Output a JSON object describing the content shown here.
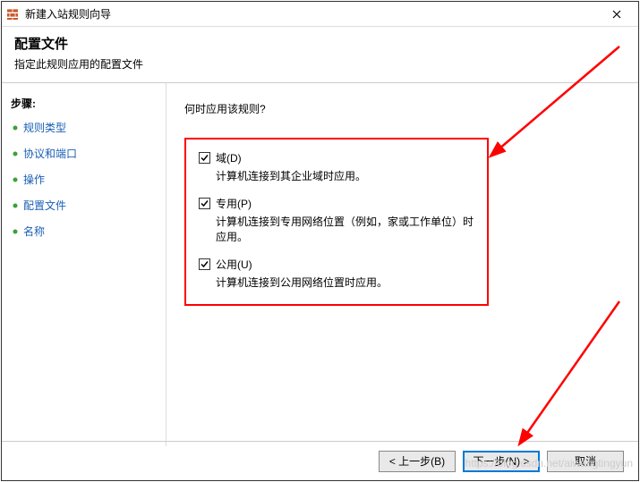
{
  "window": {
    "title": "新建入站规则向导"
  },
  "header": {
    "title": "配置文件",
    "subtitle": "指定此规则应用的配置文件"
  },
  "sidebar": {
    "heading": "步骤:",
    "steps": [
      {
        "label": "规则类型"
      },
      {
        "label": "协议和端口"
      },
      {
        "label": "操作"
      },
      {
        "label": "配置文件"
      },
      {
        "label": "名称"
      }
    ]
  },
  "main": {
    "prompt": "何时应用该规则?",
    "options": [
      {
        "label": "域(D)",
        "desc": "计算机连接到其企业域时应用。",
        "checked": true
      },
      {
        "label": "专用(P)",
        "desc": "计算机连接到专用网络位置（例如，家或工作单位）时应用。",
        "checked": true
      },
      {
        "label": "公用(U)",
        "desc": "计算机连接到公用网络位置时应用。",
        "checked": true
      }
    ]
  },
  "footer": {
    "back": "< 上一步(B)",
    "next": "下一步(N) >",
    "cancel": "取消"
  },
  "watermark": "https://blog.csdn.net/aiwangtingyun",
  "colors": {
    "highlight": "#ff0000",
    "link": "#1a5fb4",
    "primary": "#0078d7"
  }
}
